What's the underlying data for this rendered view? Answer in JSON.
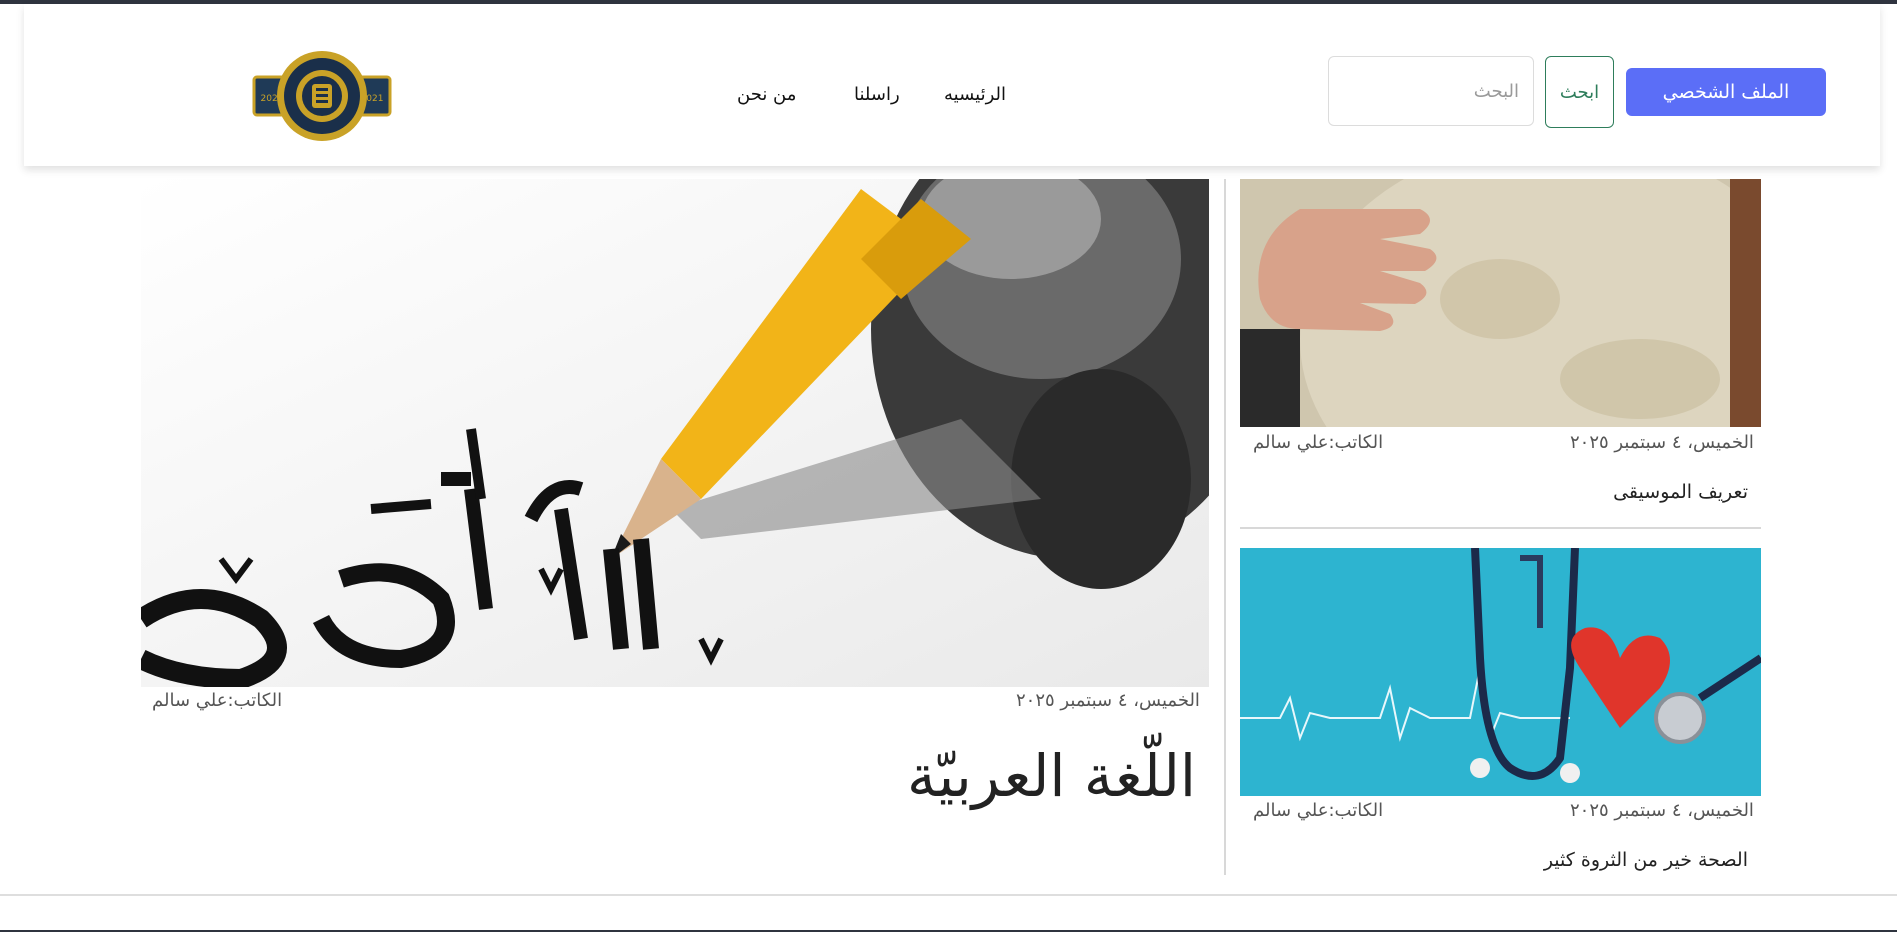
{
  "header": {
    "nav_links": [
      "الرئيسيه",
      "راسلنا",
      "من نحن"
    ],
    "search": {
      "placeholder": "البحث",
      "button_label": "ابحث"
    },
    "profile_button": "الملف الشخصي",
    "logo_year_left": "2021",
    "logo_year_right": "2021"
  },
  "featured_article": {
    "title": "اللّغة العربيّة",
    "date": "الخميس، ٤ سبتمبر ٢٠٢٥",
    "author": "الكاتب:علي سالم",
    "image": "pencil-calligraphy"
  },
  "side_articles": [
    {
      "title": "تعريف الموسيقى",
      "date": "الخميس، ٤ سبتمبر ٢٠٢٥",
      "author": "الكاتب:علي سالم",
      "image": "frame-drum"
    },
    {
      "title": "الصحة خير من الثروة كثير",
      "date": "الخميس، ٤ سبتمبر ٢٠٢٥",
      "author": "الكاتب:علي سالم",
      "image": "stethoscope-heart"
    }
  ],
  "colors": {
    "accent": "#5b6ef7",
    "search_border": "#2e7d5b",
    "topbar": "#2f343f"
  }
}
